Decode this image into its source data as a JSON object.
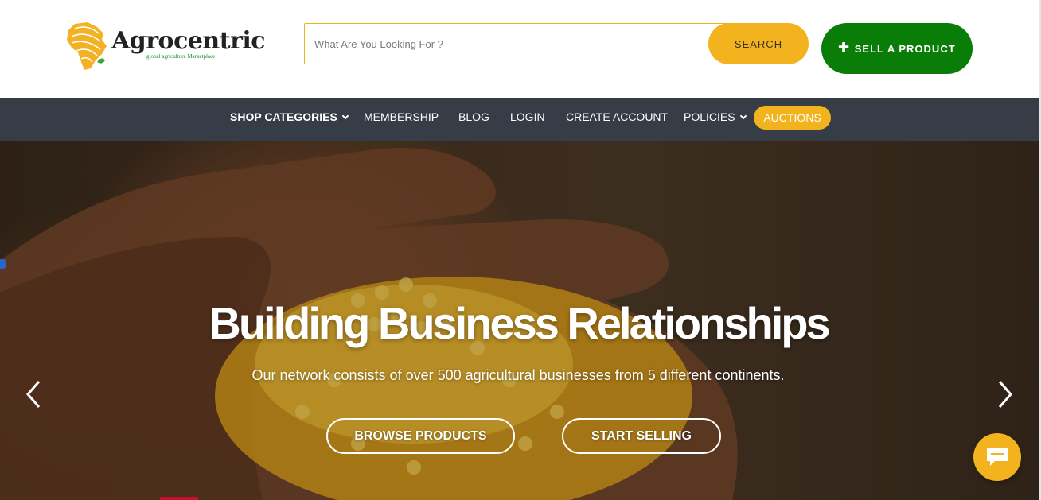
{
  "header": {
    "logo_name": "Agrocentric",
    "logo_tagline": "global agriculture Marketplace",
    "search_placeholder": "What Are You Looking For ?",
    "search_button": "SEARCH",
    "sell_button": "SELL A PRODUCT"
  },
  "nav": {
    "items": [
      {
        "label": "SHOP CATEGORIES",
        "dropdown": true
      },
      {
        "label": "MEMBERSHIP"
      },
      {
        "label": "BLOG"
      },
      {
        "label": "LOGIN"
      },
      {
        "label": "CREATE ACCOUNT"
      },
      {
        "label": "POLICIES",
        "dropdown": true
      },
      {
        "label": "AUCTIONS"
      }
    ]
  },
  "hero": {
    "title": "Building Business Relationships",
    "subtitle": "Our network consists of over 500 agricultural businesses from 5 different continents.",
    "browse_button": "BROWSE PRODUCTS",
    "start_button": "START SELLING"
  },
  "colors": {
    "accent_yellow": "#f2b31f",
    "sell_green": "#0a7d08",
    "nav_bg": "#373d46"
  },
  "icons": {
    "prev": "chevron-left-icon",
    "next": "chevron-right-icon",
    "chat": "chat-bubble-icon",
    "plus": "plus-icon",
    "dropdown": "chevron-down-icon"
  }
}
